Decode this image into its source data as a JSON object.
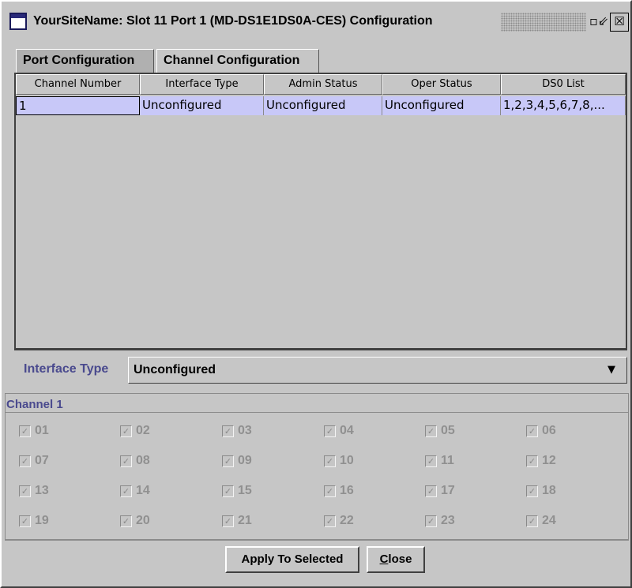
{
  "window": {
    "title": "YourSiteName: Slot 11 Port 1 (MD-DS1E1DS0A-CES) Configuration",
    "restore_glyph": "▫⇙",
    "close_glyph": "☒"
  },
  "tabs": [
    {
      "label": "Port Configuration",
      "selected": false
    },
    {
      "label": "Channel Configuration",
      "selected": true
    }
  ],
  "table": {
    "columns": [
      "Channel Number",
      "Interface Type",
      "Admin Status",
      "Oper Status",
      "DS0 List"
    ],
    "rows": [
      [
        "1",
        "Unconfigured",
        "Unconfigured",
        "Unconfigured",
        "1,2,3,4,5,6,7,8,..."
      ]
    ]
  },
  "interface": {
    "label": "Interface Type",
    "value": "Unconfigured",
    "arrow": "▼"
  },
  "channel": {
    "title": "Channel 1",
    "checkboxes": [
      "01",
      "02",
      "03",
      "04",
      "05",
      "06",
      "07",
      "08",
      "09",
      "10",
      "11",
      "12",
      "13",
      "14",
      "15",
      "16",
      "17",
      "18",
      "19",
      "20",
      "21",
      "22",
      "23",
      "24"
    ],
    "check_glyph": "✓"
  },
  "buttons": {
    "apply": "Apply To Selected",
    "close_mnemonic": "C",
    "close_rest": "lose"
  },
  "colors": {
    "selection": "#c8c8f8",
    "label_accent": "#4a4a8e",
    "disabled_text": "#909090"
  }
}
